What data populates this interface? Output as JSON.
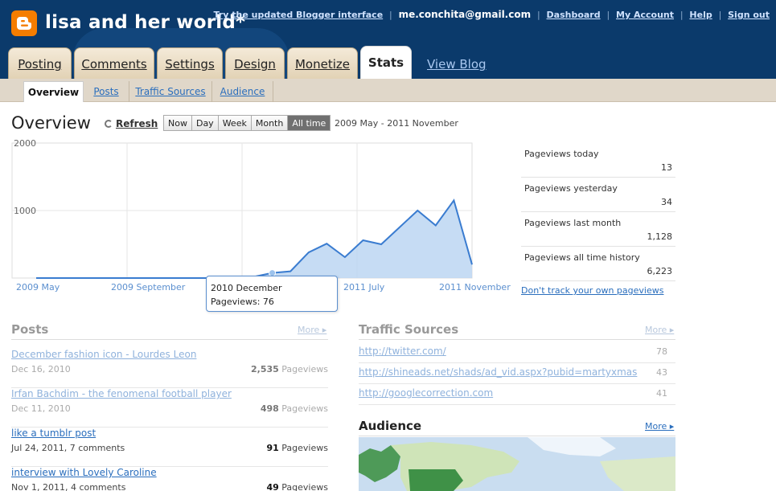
{
  "header": {
    "blog_title": "lisa and her world*",
    "links": {
      "updated_ui": "Try the updated Blogger interface",
      "email": "me.conchita@gmail.com",
      "dashboard": "Dashboard",
      "account": "My Account",
      "help": "Help",
      "signout": "Sign out"
    },
    "tabs": [
      {
        "label": "Posting"
      },
      {
        "label": "Comments"
      },
      {
        "label": "Settings"
      },
      {
        "label": "Design"
      },
      {
        "label": "Monetize"
      },
      {
        "label": "Stats",
        "active": true
      }
    ],
    "view_blog": "View Blog"
  },
  "subnav": [
    {
      "label": "Overview",
      "active": true
    },
    {
      "label": "Posts"
    },
    {
      "label": "Traffic Sources"
    },
    {
      "label": "Audience"
    }
  ],
  "overview": {
    "title": "Overview",
    "refresh": "Refresh",
    "ranges": [
      "Now",
      "Day",
      "Week",
      "Month",
      "All time"
    ],
    "selected_range": "All time",
    "date_range": "2009 May - 2011 November"
  },
  "chart_data": {
    "type": "area",
    "y_ticks": [
      "2000",
      "1000"
    ],
    "ylim": [
      0,
      2000
    ],
    "x_labels": [
      "2009 May",
      "2009 September",
      "2010 December",
      "2011 July",
      "2011 November"
    ],
    "values": [
      0,
      0,
      0,
      0,
      0,
      0,
      0,
      0,
      0,
      0,
      0,
      5,
      20,
      76,
      100,
      380,
      510,
      310,
      560,
      500,
      750,
      1000,
      780,
      1150,
      200
    ],
    "fill_color": "#bcd6f2",
    "line_color": "#3a7cd0",
    "tooltip": {
      "title": "2010 December",
      "label": "Pageviews",
      "value": "76",
      "index": 13
    }
  },
  "stats": [
    {
      "label": "Pageviews today",
      "value": "13"
    },
    {
      "label": "Pageviews yesterday",
      "value": "34"
    },
    {
      "label": "Pageviews last month",
      "value": "1,128"
    },
    {
      "label": "Pageviews all time history",
      "value": "6,223"
    }
  ],
  "dont_track": "Don't track your own pageviews",
  "posts": {
    "title": "Posts",
    "more": "More ▸",
    "items": [
      {
        "title": "December fashion icon - Lourdes Leon",
        "meta": "Dec 16, 2010",
        "count": "2,535",
        "unit": "Pageviews"
      },
      {
        "title": "Irfan Bachdim - the fenomenal football player",
        "meta": "Dec 11, 2010",
        "count": "498",
        "unit": "Pageviews"
      },
      {
        "title": "like a tumblr post",
        "meta": "Jul 24, 2011, 7 comments",
        "count": "91",
        "unit": "Pageviews"
      },
      {
        "title": "interview with Lovely Caroline",
        "meta": "Nov 1, 2011, 4 comments",
        "count": "49",
        "unit": "Pageviews"
      }
    ]
  },
  "traffic": {
    "title": "Traffic Sources",
    "more": "More ▸",
    "items": [
      {
        "url": "http://twitter.com/",
        "count": "78"
      },
      {
        "url": "http://shineads.net/shads/ad_vid.aspx?pubid=martyxmas",
        "count": "43"
      },
      {
        "url": "http://googlecorrection.com",
        "count": "41"
      }
    ]
  },
  "audience": {
    "title": "Audience",
    "more": "More ▸"
  }
}
